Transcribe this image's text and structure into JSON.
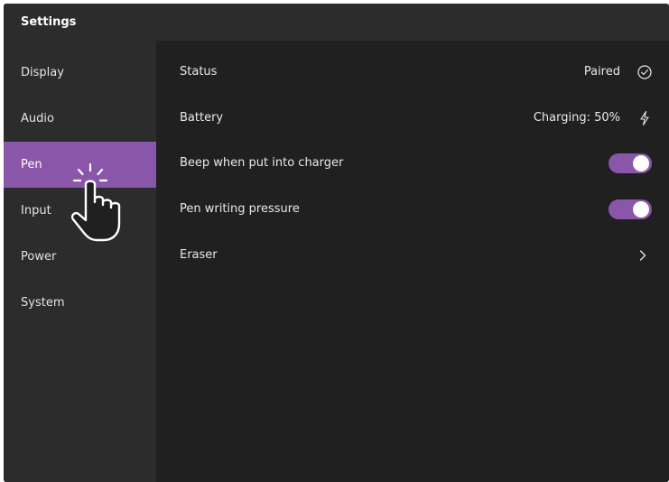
{
  "window": {
    "title": "Settings"
  },
  "sidebar": {
    "items": [
      {
        "label": "Display",
        "active": false
      },
      {
        "label": "Audio",
        "active": false
      },
      {
        "label": "Pen",
        "active": true
      },
      {
        "label": "Input",
        "active": false
      },
      {
        "label": "Power",
        "active": false
      },
      {
        "label": "System",
        "active": false
      }
    ]
  },
  "pen_settings": {
    "status": {
      "label": "Status",
      "value": "Paired",
      "icon": "check-circle-icon"
    },
    "battery": {
      "label": "Battery",
      "value": "Charging: 50%",
      "icon": "lightning-icon"
    },
    "beep": {
      "label": "Beep when put into charger",
      "on": true
    },
    "pressure": {
      "label": "Pen writing pressure",
      "on": true
    },
    "eraser": {
      "label": "Eraser",
      "icon": "chevron-right-icon"
    }
  },
  "cursor": {
    "icon": "hand-pointer-click-icon"
  },
  "colors": {
    "accent": "#8a56a9",
    "sidebar_bg": "#2c2c2c",
    "content_bg": "#202020",
    "text": "#e8e8e8"
  }
}
